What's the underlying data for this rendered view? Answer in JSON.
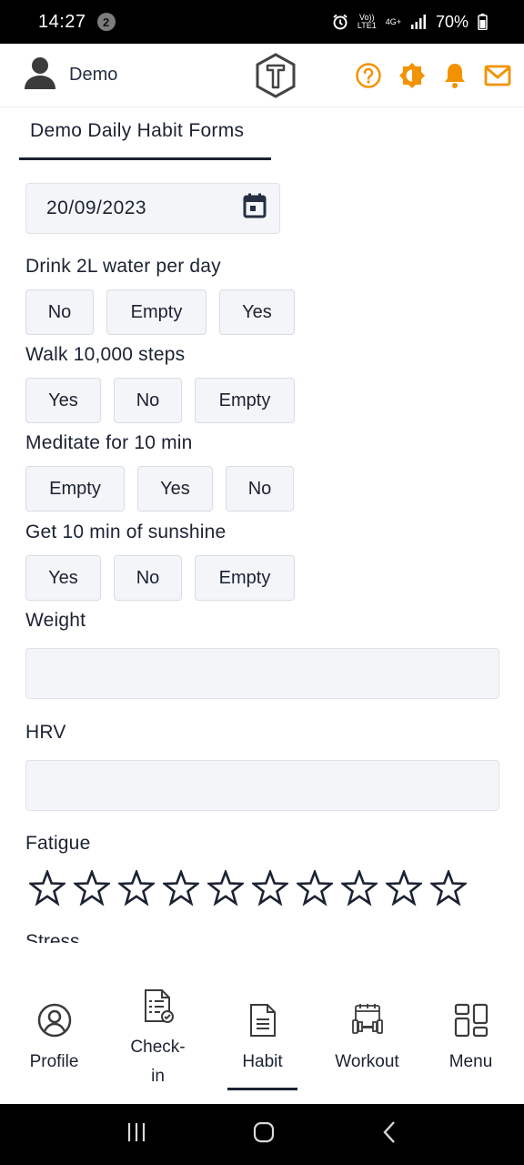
{
  "status_bar": {
    "time": "14:27",
    "notification_count": "2",
    "volte_label": "Vo))",
    "lte_label": "LTE1",
    "network_label": "4G+",
    "battery": "70%"
  },
  "header": {
    "user_name": "Demo",
    "icons": [
      "user-icon",
      "logo-icon",
      "help-icon",
      "brightness-icon",
      "bell-icon",
      "mail-icon"
    ],
    "accent_color": "#f39200"
  },
  "tab": {
    "title": "Demo Daily Habit Forms"
  },
  "date_field": {
    "value": "20/09/2023"
  },
  "habits": [
    {
      "question": "Drink 2L water per day",
      "options": [
        "No",
        "Empty",
        "Yes"
      ]
    },
    {
      "question": "Walk 10,000 steps",
      "options": [
        "Yes",
        "No",
        "Empty"
      ]
    },
    {
      "question": "Meditate for 10 min",
      "options": [
        "Empty",
        "Yes",
        "No"
      ]
    },
    {
      "question": "Get 10 min of sunshine",
      "options": [
        "Yes",
        "No",
        "Empty"
      ]
    }
  ],
  "weight": {
    "label": "Weight",
    "value": ""
  },
  "hrv": {
    "label": "HRV",
    "value": ""
  },
  "fatigue": {
    "label": "Fatigue",
    "rating": 0,
    "max": 10
  },
  "next_label": "Stress",
  "bottom_nav": {
    "items": [
      {
        "label": "Profile",
        "icon": "profile-icon"
      },
      {
        "label": "Check-\nin",
        "icon": "checkin-icon"
      },
      {
        "label": "Habit",
        "icon": "habit-icon",
        "active": true
      },
      {
        "label": "Workout",
        "icon": "workout-icon"
      },
      {
        "label": "Menu",
        "icon": "menu-icon"
      }
    ]
  }
}
